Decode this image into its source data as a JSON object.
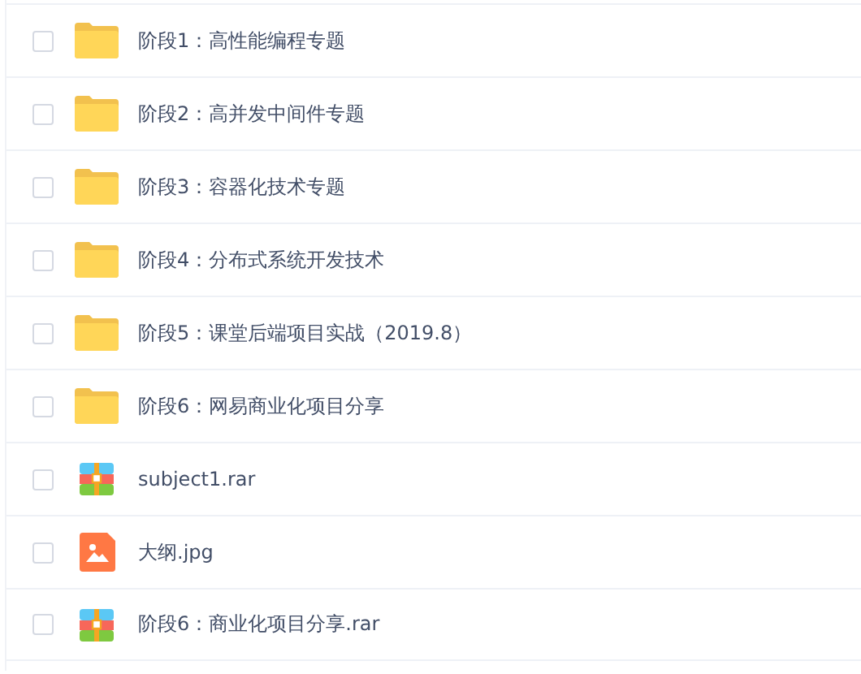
{
  "files": [
    {
      "name": "阶段1：高性能编程专题",
      "kind": "folder",
      "checked": false
    },
    {
      "name": "阶段2：高并发中间件专题",
      "kind": "folder",
      "checked": false
    },
    {
      "name": "阶段3：容器化技术专题",
      "kind": "folder",
      "checked": false
    },
    {
      "name": "阶段4：分布式系统开发技术",
      "kind": "folder",
      "checked": false
    },
    {
      "name": "阶段5：课堂后端项目实战（2019.8）",
      "kind": "folder",
      "checked": false
    },
    {
      "name": "阶段6：网易商业化项目分享",
      "kind": "folder",
      "checked": false
    },
    {
      "name": "subject1.rar",
      "kind": "archive",
      "checked": false
    },
    {
      "name": "大纲.jpg",
      "kind": "image",
      "checked": false
    },
    {
      "name": "阶段6：商业化项目分享.rar",
      "kind": "archive",
      "checked": false
    }
  ]
}
